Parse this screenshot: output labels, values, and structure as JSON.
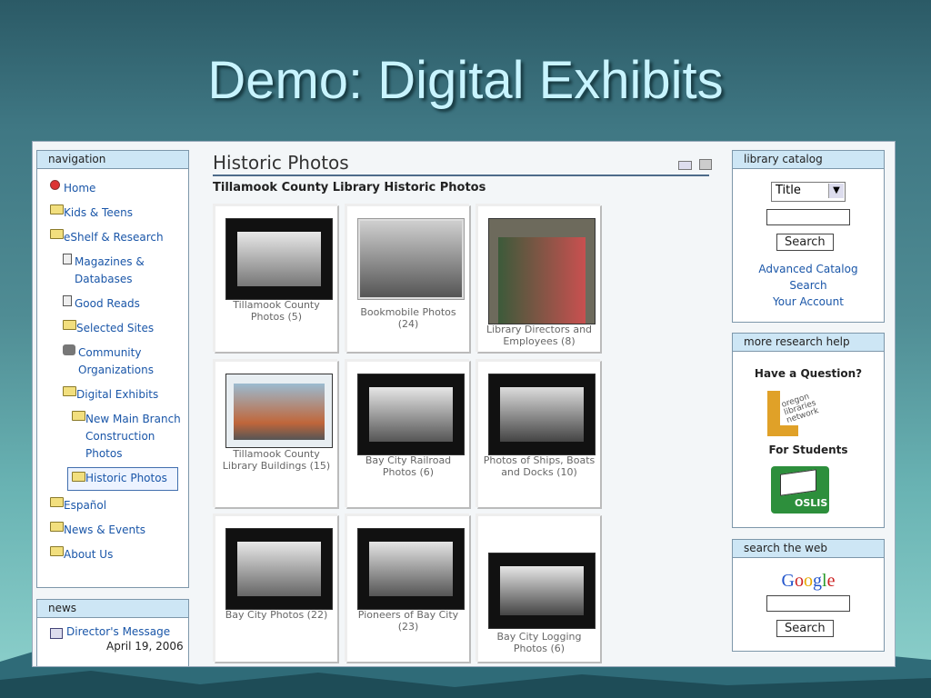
{
  "slide": {
    "title": "Demo: Digital Exhibits"
  },
  "navigation": {
    "heading": "navigation",
    "items": [
      {
        "label": "Home",
        "icon": "globe-icon"
      },
      {
        "label": "Kids & Teens",
        "icon": "folder-icon"
      },
      {
        "label": "eShelf & Research",
        "icon": "folder-icon"
      },
      {
        "label": "Magazines &",
        "label2": "Databases",
        "icon": "document-icon"
      },
      {
        "label": "Good Reads",
        "icon": "document-icon"
      },
      {
        "label": "Selected Sites",
        "icon": "folder-icon"
      },
      {
        "label": "Community",
        "label2": "Organizations",
        "icon": "people-icon"
      },
      {
        "label": "Digital Exhibits",
        "icon": "folder-icon"
      },
      {
        "label": "New Main Branch",
        "label2": "Construction",
        "label3": "Photos",
        "icon": "folder-icon"
      },
      {
        "label": "Historic Photos",
        "icon": "folder-icon"
      },
      {
        "label": "Español",
        "icon": "folder-icon"
      },
      {
        "label": "News & Events",
        "icon": "folder-icon"
      },
      {
        "label": "About Us",
        "icon": "folder-icon"
      }
    ]
  },
  "news": {
    "heading": "news",
    "item": "Director's Message",
    "date": "April 19, 2006"
  },
  "content": {
    "title": "Historic Photos",
    "subtitle": "Tillamook County Library Historic Photos",
    "tiles": [
      {
        "caption": "Tillamook County Photos (5)"
      },
      {
        "caption": "Bookmobile Photos (24)"
      },
      {
        "caption": "Library Directors and Employees (8)"
      },
      {
        "caption": "Tillamook County Library Buildings (15)"
      },
      {
        "caption": "Bay City Railroad Photos (6)"
      },
      {
        "caption": "Photos of Ships, Boats and Docks (10)"
      },
      {
        "caption": "Bay City Photos (22)"
      },
      {
        "caption": "Pioneers of Bay City (23)"
      },
      {
        "caption": "Bay City Logging Photos (6)"
      }
    ]
  },
  "library_catalog": {
    "heading": "library catalog",
    "select_value": "Title",
    "search_button": "Search",
    "advanced_link": "Advanced Catalog",
    "advanced_link2": "Search",
    "account_link": "Your Account"
  },
  "research_help": {
    "heading": "more research help",
    "question": "Have a Question?",
    "students": "For Students"
  },
  "search_web": {
    "heading": "search the web",
    "search_button": "Search"
  }
}
